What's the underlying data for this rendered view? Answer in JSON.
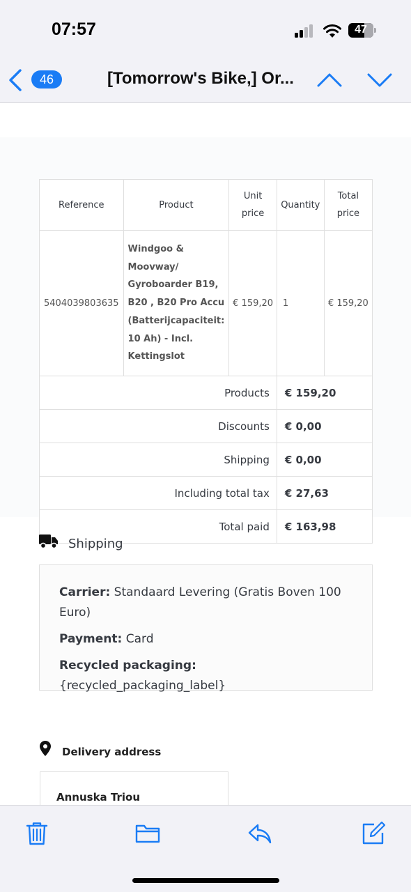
{
  "status_bar": {
    "time": "07:57",
    "battery": "47"
  },
  "nav": {
    "unread_count": "46",
    "title": "[Tomorrow's Bike,] Or..."
  },
  "order_table": {
    "headers": {
      "reference": "Reference",
      "product": "Product",
      "unit_price": "Unit price",
      "quantity": "Quantity",
      "total_price": "Total price"
    },
    "rows": [
      {
        "reference": "5404039803635",
        "product": "Windgoo & Moovway/ Gyroboarder B19, B20 , B20 Pro Accu (Batterijcapaciteit: 10 Ah) - Incl. Kettingslot",
        "unit_price": "€ 159,20",
        "quantity": "1",
        "total_price": "€ 159,20"
      }
    ],
    "summary": [
      {
        "label": "Products",
        "value": "€ 159,20"
      },
      {
        "label": "Discounts",
        "value": "€ 0,00"
      },
      {
        "label": "Shipping",
        "value": "€ 0,00"
      },
      {
        "label": "Including total tax",
        "value": "€ 27,63"
      },
      {
        "label": "Total paid",
        "value": "€ 163,98"
      }
    ]
  },
  "shipping": {
    "title": "Shipping",
    "carrier_label": "Carrier:",
    "carrier_value": "Standaard Levering (Gratis Boven 100 Euro)",
    "payment_label": "Payment:",
    "payment_value": "Card",
    "recycled_label": "Recycled packaging:",
    "recycled_value": "{recycled_packaging_label}"
  },
  "delivery": {
    "title": "Delivery address",
    "name": "Annuska Triou"
  },
  "icons": {
    "back": "chevron-left-icon",
    "prev": "chevron-up-icon",
    "next": "chevron-down-icon",
    "shipping": "truck-icon",
    "delivery": "location-pin-icon",
    "trash": "trash-icon",
    "folder": "folder-icon",
    "reply": "reply-icon",
    "compose": "compose-icon"
  },
  "colors": {
    "accent": "#1a7cf5",
    "text": "#363a41",
    "border": "#dfdfdf"
  }
}
